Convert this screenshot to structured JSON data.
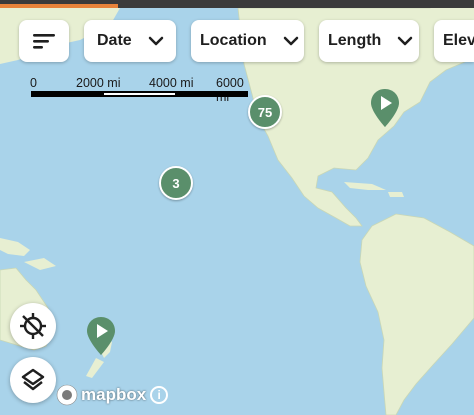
{
  "filters": {
    "sort_icon": "sort-lines-icon",
    "chips": [
      {
        "label": "Date"
      },
      {
        "label": "Location"
      },
      {
        "label": "Length"
      },
      {
        "label": "Elev"
      }
    ]
  },
  "scale_bar": {
    "labels": [
      "0",
      "2000 mi",
      "4000 mi",
      "6000 mi"
    ]
  },
  "clusters": [
    {
      "count": "75"
    },
    {
      "count": "3"
    }
  ],
  "markers": [
    {
      "icon": "play-pin-icon"
    },
    {
      "icon": "play-pin-icon"
    }
  ],
  "controls": {
    "location_icon": "location-disabled-icon",
    "layers_icon": "layers-icon"
  },
  "attribution": {
    "text": "mapbox",
    "info": "i"
  },
  "colors": {
    "water": "#a9d3ea",
    "land": "#e7efd2",
    "marker": "#5a8f6b",
    "accent": "#e8833a"
  }
}
